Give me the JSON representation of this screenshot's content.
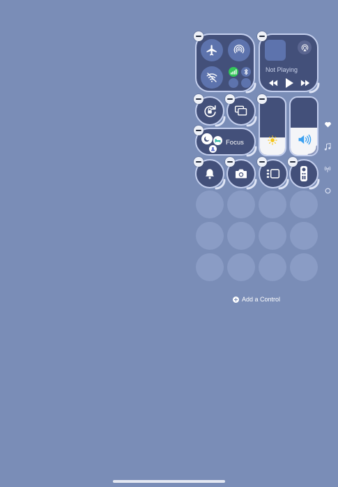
{
  "media": {
    "status": "Not Playing"
  },
  "focus": {
    "label": "Focus"
  },
  "add_control": {
    "label": "Add a Control"
  },
  "icons": {
    "airplane": "airplane-icon",
    "airdrop": "airdrop-icon",
    "wifi": "wifi-off-icon",
    "cellular": "cellular-icon",
    "bluetooth": "bluetooth-icon",
    "airplay": "airplay-icon",
    "rotation_lock": "rotation-lock-icon",
    "screen_mirroring": "screen-mirroring-icon",
    "brightness": "sun-icon",
    "volume": "speaker-icon",
    "silent_mode": "bell-icon",
    "camera": "camera-icon",
    "stage_manager": "stage-manager-icon",
    "remote": "remote-icon",
    "sidebar": [
      "heart-icon",
      "music-note-icon",
      "antenna-icon",
      "circle-icon"
    ]
  },
  "colors": {
    "background": "#7a8db7",
    "tile": "#43507a",
    "cellular_active": "#34c759",
    "volume_accent": "#3aa0f0",
    "brightness_accent": "#f5c518"
  },
  "sliders": {
    "brightness_level": 0.3,
    "volume_level": 0.48
  }
}
